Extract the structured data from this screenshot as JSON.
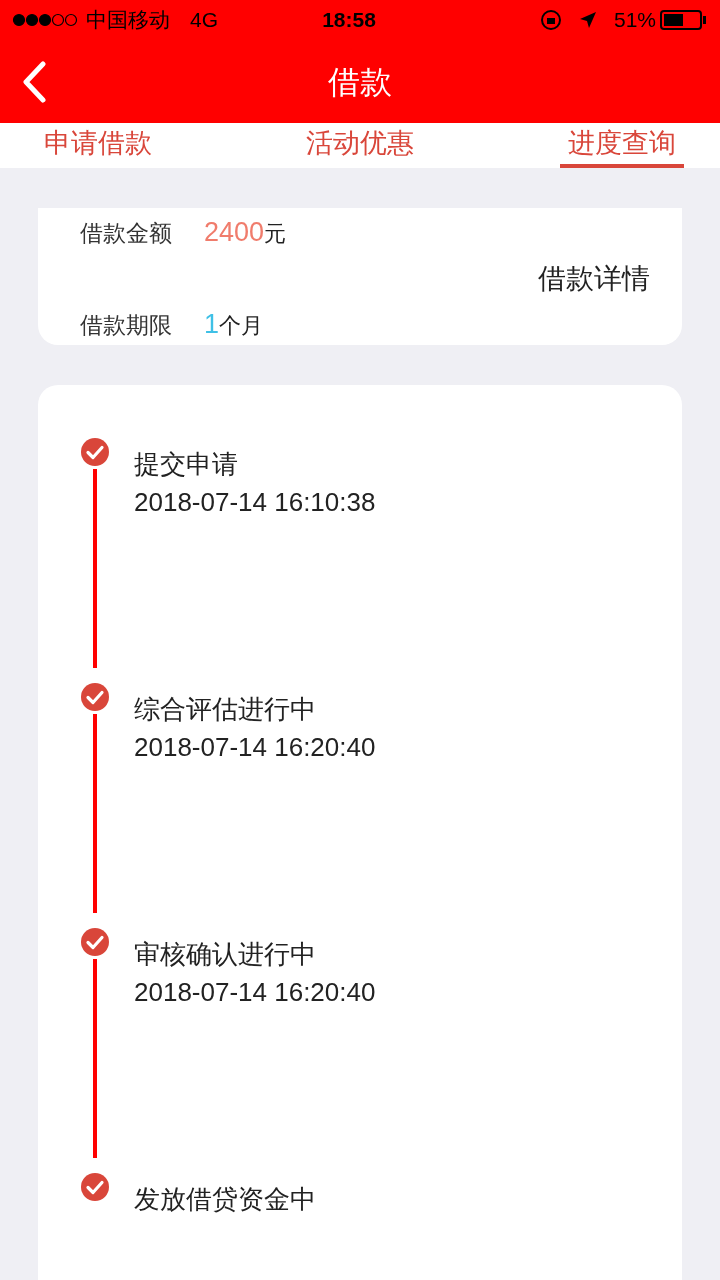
{
  "status_bar": {
    "carrier": "中国移动",
    "network": "4G",
    "time": "18:58",
    "battery": "51%"
  },
  "header": {
    "title": "借款"
  },
  "tabs": [
    {
      "label": "申请借款",
      "selected": false
    },
    {
      "label": "活动优惠",
      "selected": false
    },
    {
      "label": "进度查询",
      "selected": true
    }
  ],
  "loan": {
    "amount_label": "借款金额",
    "amount": "2400",
    "amount_unit": "元",
    "details_link": "借款详情",
    "term_label": "借款期限",
    "term": "1",
    "term_unit": "个月"
  },
  "steps": [
    {
      "title": "提交申请",
      "time": "2018-07-14 16:10:38",
      "done": true
    },
    {
      "title": "综合评估进行中",
      "time": "2018-07-14 16:20:40",
      "done": true
    },
    {
      "title": "审核确认进行中",
      "time": "2018-07-14 16:20:40",
      "done": true
    },
    {
      "title": "发放借贷资金中",
      "done": true
    }
  ]
}
